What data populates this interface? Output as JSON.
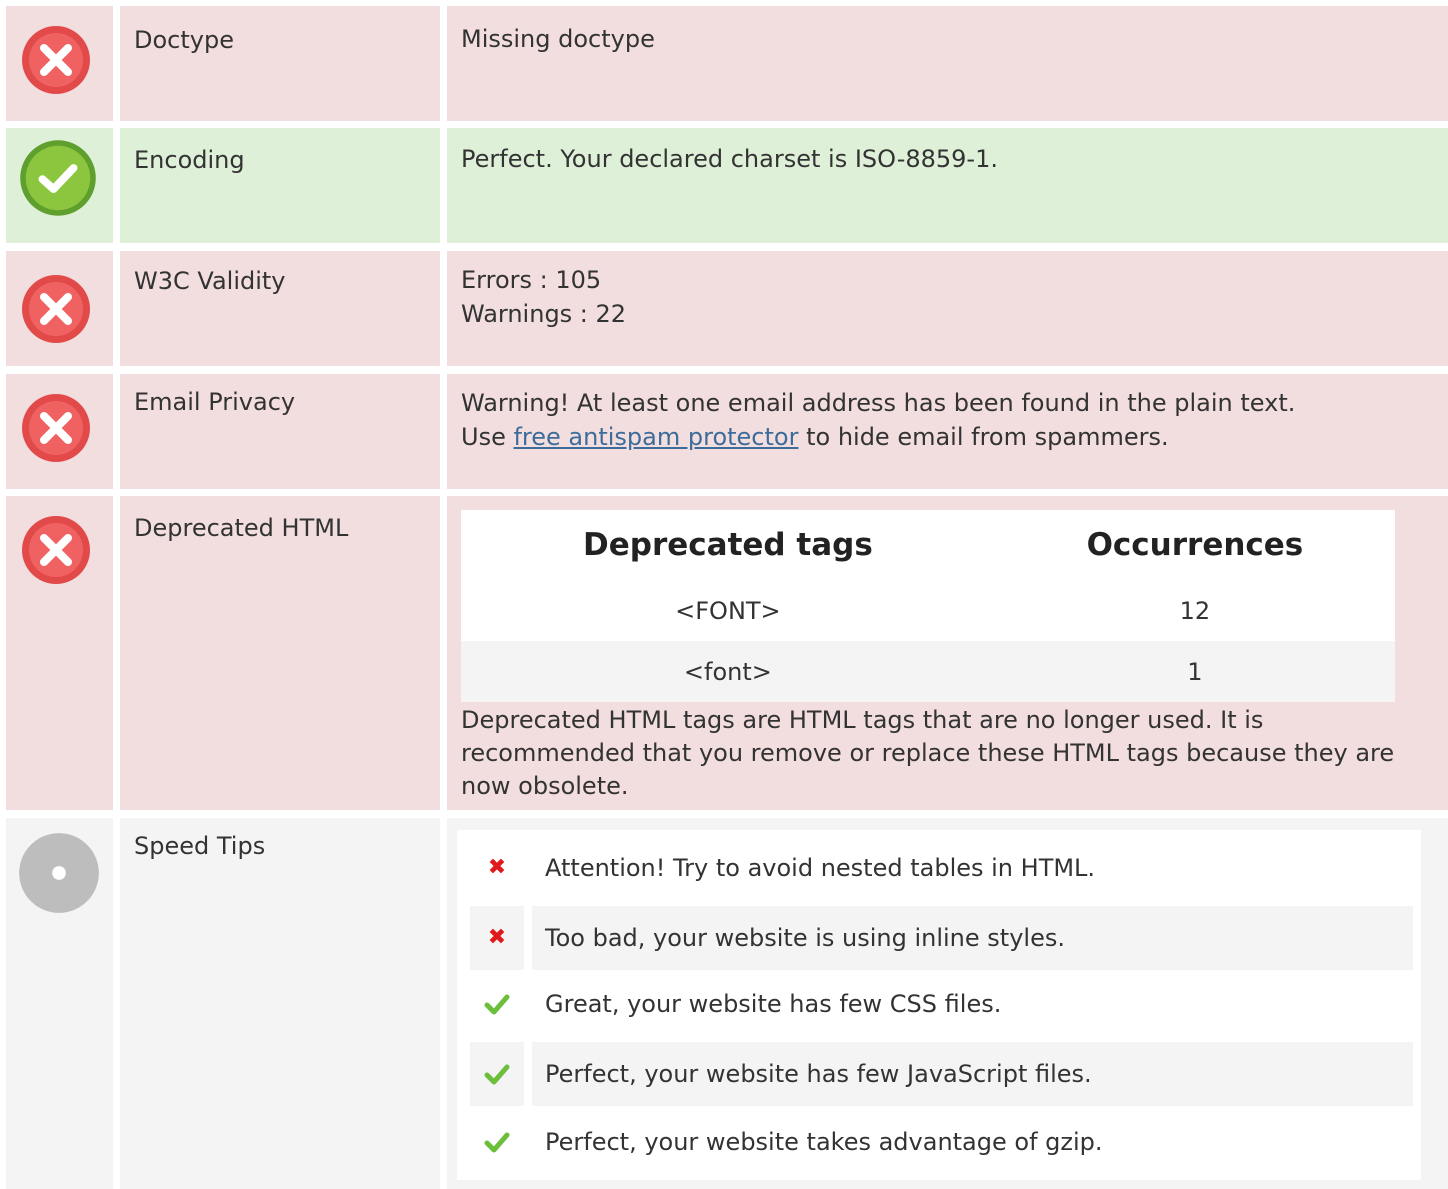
{
  "colors": {
    "bad_bg": "#f2dedf",
    "good_bg": "#dff0d8",
    "neutral_bg": "#f4f4f4",
    "link": "#3e6c9a",
    "error_icon": "#e24a4a",
    "success_icon": "#7cc23e",
    "neutral_icon": "#bdbdbd"
  },
  "rows": {
    "doctype": {
      "status": "error",
      "label": "Doctype",
      "value": "Missing doctype"
    },
    "encoding": {
      "status": "success",
      "label": "Encoding",
      "value": "Perfect. Your declared charset is ISO-8859-1."
    },
    "w3c": {
      "status": "error",
      "label": "W3C Validity",
      "line1": "Errors : 105",
      "line2": "Warnings : 22"
    },
    "email": {
      "status": "error",
      "label": "Email Privacy",
      "line1": "Warning! At least one email address has been found in the plain text.",
      "line2_prefix": "Use ",
      "link": "free antispam protector",
      "line2_suffix": " to hide email from spammers."
    },
    "deprecated": {
      "status": "error",
      "label": "Deprecated HTML",
      "table_headers": [
        "Deprecated tags",
        "Occurrences"
      ],
      "table_rows": [
        {
          "tag": "<FONT>",
          "count": "12"
        },
        {
          "tag": "<font>",
          "count": "1"
        }
      ],
      "note": "Deprecated HTML tags are HTML tags that are no longer used. It is recommended that you remove or replace these HTML tags because they are now obsolete."
    },
    "speed": {
      "status": "neutral",
      "label": "Speed Tips",
      "tips": [
        {
          "icon": "x-mark-icon",
          "text": "Attention! Try to avoid nested tables in HTML."
        },
        {
          "icon": "x-mark-icon",
          "text": "Too bad, your website is using inline styles."
        },
        {
          "icon": "check-mark-icon",
          "text": "Great, your website has few CSS files."
        },
        {
          "icon": "check-mark-icon",
          "text": "Perfect, your website has few JavaScript files."
        },
        {
          "icon": "check-mark-icon",
          "text": "Perfect, your website takes advantage of gzip."
        }
      ]
    }
  }
}
